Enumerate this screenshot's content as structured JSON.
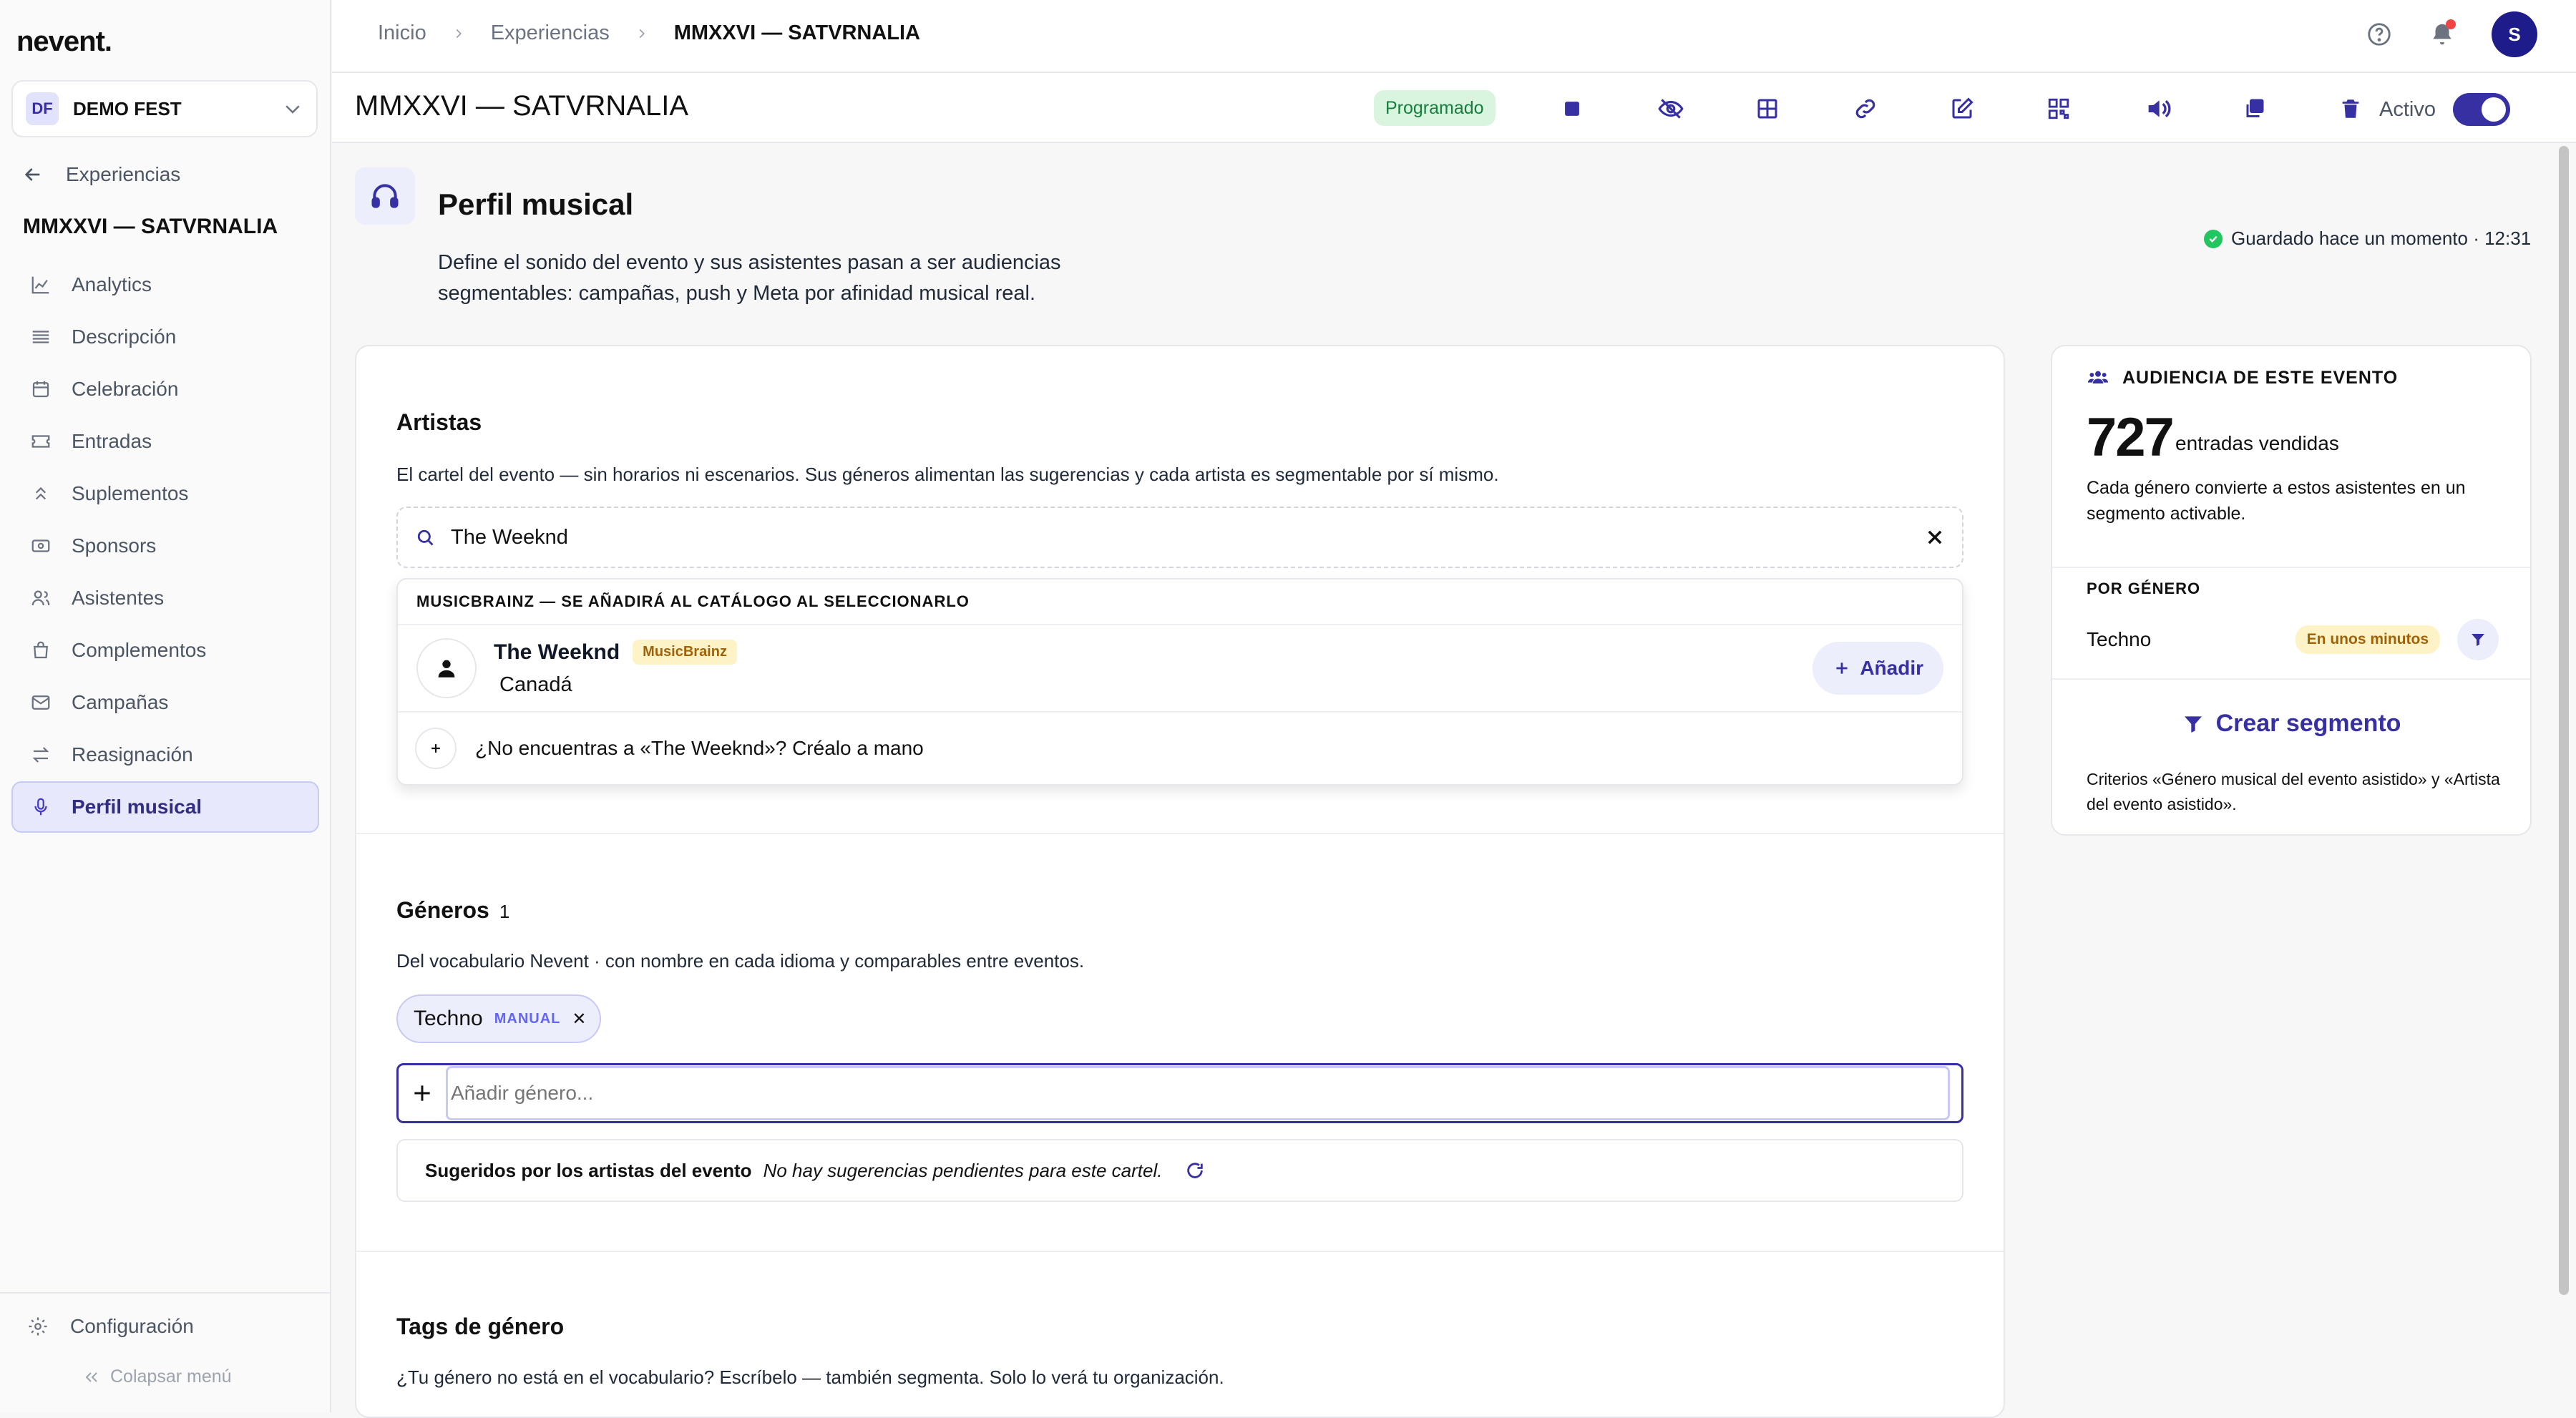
{
  "app": {
    "logo": "nevent."
  },
  "org": {
    "badge": "DF",
    "name": "DEMO FEST"
  },
  "sidebar": {
    "back_label": "Experiencias",
    "event_name": "MMXXVI — SATVRNALIA",
    "items": [
      {
        "label": "Analytics",
        "icon": "chart-icon"
      },
      {
        "label": "Descripción",
        "icon": "list-icon"
      },
      {
        "label": "Celebración",
        "icon": "calendar-icon"
      },
      {
        "label": "Entradas",
        "icon": "ticket-icon"
      },
      {
        "label": "Suplementos",
        "icon": "chevrons-up-icon"
      },
      {
        "label": "Sponsors",
        "icon": "banknote-icon"
      },
      {
        "label": "Asistentes",
        "icon": "users-icon"
      },
      {
        "label": "Complementos",
        "icon": "bag-icon"
      },
      {
        "label": "Campañas",
        "icon": "mail-icon"
      },
      {
        "label": "Reasignación",
        "icon": "swap-icon"
      },
      {
        "label": "Perfil musical",
        "icon": "mic-icon",
        "active": true
      }
    ],
    "config_label": "Configuración",
    "collapse_label": "Colapsar menú"
  },
  "topbar": {
    "breadcrumbs": [
      "Inicio",
      "Experiencias",
      "MMXXVI — SATVRNALIA"
    ],
    "avatar_initial": "S"
  },
  "subheader": {
    "title": "MMXXVI — SATVRNALIA",
    "status": "Programado",
    "actions": [
      "stop-icon",
      "eye-off-icon",
      "grid-icon",
      "link-icon",
      "edit-icon",
      "qr-icon",
      "volume-icon",
      "copy-icon",
      "trash-icon"
    ],
    "active_label": "Activo",
    "active": true
  },
  "page": {
    "title": "Perfil musical",
    "description": "Define el sonido del evento y sus asistentes pasan a ser audiencias segmentables: campañas, push y Meta por afinidad musical real.",
    "saved_status": "Guardado hace un momento · 12:31"
  },
  "artists": {
    "title": "Artistas",
    "description": "El cartel del evento — sin horarios ni escenarios. Sus géneros alimentan las sugerencias y cada artista es segmentable por sí mismo.",
    "search_value": "The Weeknd",
    "dropdown": {
      "header": "MUSICBRAINZ — SE AÑADIRÁ AL CATÁLOGO AL SELECCIONARLO",
      "result": {
        "name": "The Weeknd",
        "source": "MusicBrainz",
        "country": "Canadá",
        "add_label": "Añadir"
      },
      "create_label": "¿No encuentras a «The Weeknd»? Créalo a mano"
    }
  },
  "genres": {
    "title": "Géneros",
    "count": "1",
    "description": "Del vocabulario Nevent · con nombre en cada idioma y comparables entre eventos.",
    "chips": [
      {
        "label": "Techno",
        "tag": "MANUAL"
      }
    ],
    "add_placeholder": "Añadir género...",
    "suggestions_label": "Sugeridos por los artistas del evento",
    "suggestions_empty": "No hay sugerencias pendientes para este cartel."
  },
  "tags": {
    "title": "Tags de género",
    "description": "¿Tu género no está en el vocabulario? Escríbelo — también segmenta. Solo lo verá tu organización."
  },
  "audience": {
    "header": "AUDIENCIA DE ESTE EVENTO",
    "sold_count": "727",
    "sold_label": "entradas vendidas",
    "description": "Cada género convierte a estos asistentes en un segmento activable.",
    "by_genre_label": "POR GÉNERO",
    "genres": [
      {
        "name": "Techno",
        "status": "En unos minutos"
      }
    ],
    "create_segment_label": "Crear segmento",
    "note": "Criterios «Género musical del evento asistido» y «Artista del evento asistido»."
  },
  "colors": {
    "accent": "#3730a3",
    "accent_soft": "#eceefb",
    "success": "#22c55e",
    "warning_text": "#a16207",
    "warning_bg": "#fef3c7"
  }
}
